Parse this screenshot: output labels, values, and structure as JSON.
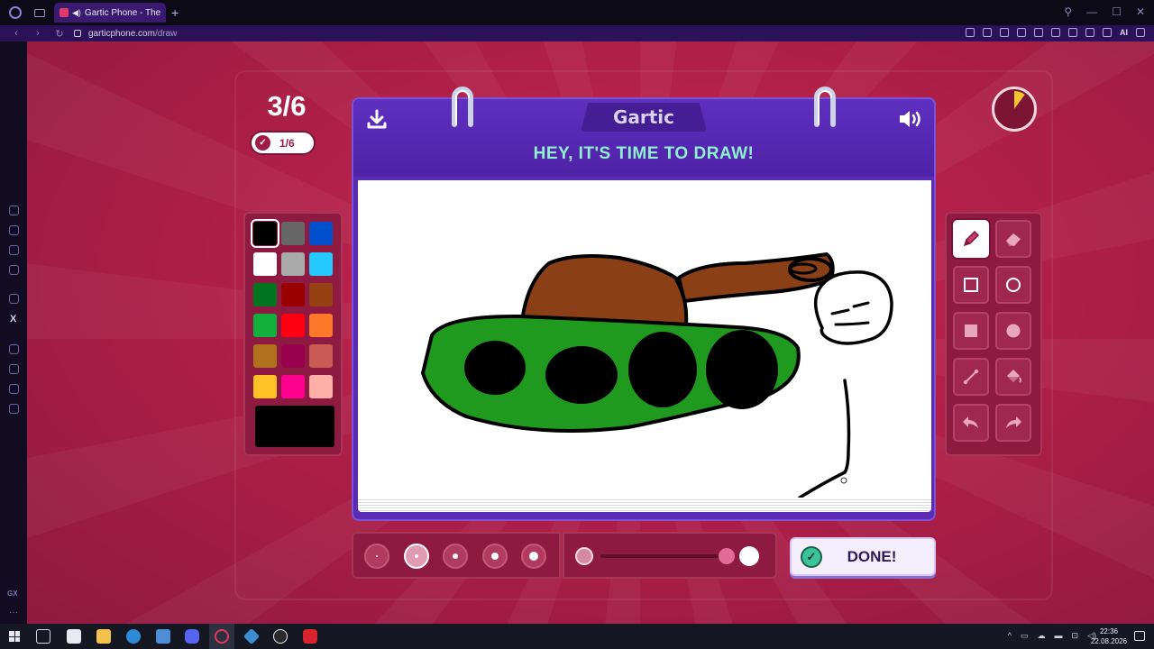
{
  "browser": {
    "tab_title": "Gartic Phone - The Tele",
    "new_tab_label": "+",
    "url_host": "garticphone.com",
    "url_path": "/draw",
    "ai_label": "AI"
  },
  "game": {
    "round": "3/6",
    "players_done": "1/6",
    "logo": "Gartic",
    "prompt": "HEY, IT'S TIME TO DRAW!",
    "done_button": "DONE!",
    "timer_remaining_fraction": 0.9,
    "colors": [
      "#000000",
      "#666666",
      "#0050cd",
      "#ffffff",
      "#aaaaaa",
      "#26c9ff",
      "#017420",
      "#990000",
      "#964112",
      "#11b03c",
      "#ff0013",
      "#ff7829",
      "#b0701c",
      "#99004e",
      "#cb5a57",
      "#ffc126",
      "#ff008f",
      "#feafa8"
    ],
    "selected_color": "#000000",
    "tools": [
      "pencil-icon",
      "eraser-icon",
      "rectangle-outline-icon",
      "circle-outline-icon",
      "rectangle-filled-icon",
      "circle-filled-icon",
      "line-icon",
      "fill-bucket-icon",
      "undo-icon",
      "redo-icon"
    ],
    "selected_tool": "pencil-icon",
    "thickness_levels": 5,
    "selected_thickness": 2,
    "opacity_fraction": 1.0
  },
  "taskbar": {
    "time": "22:36",
    "date": "22.08.2026"
  }
}
